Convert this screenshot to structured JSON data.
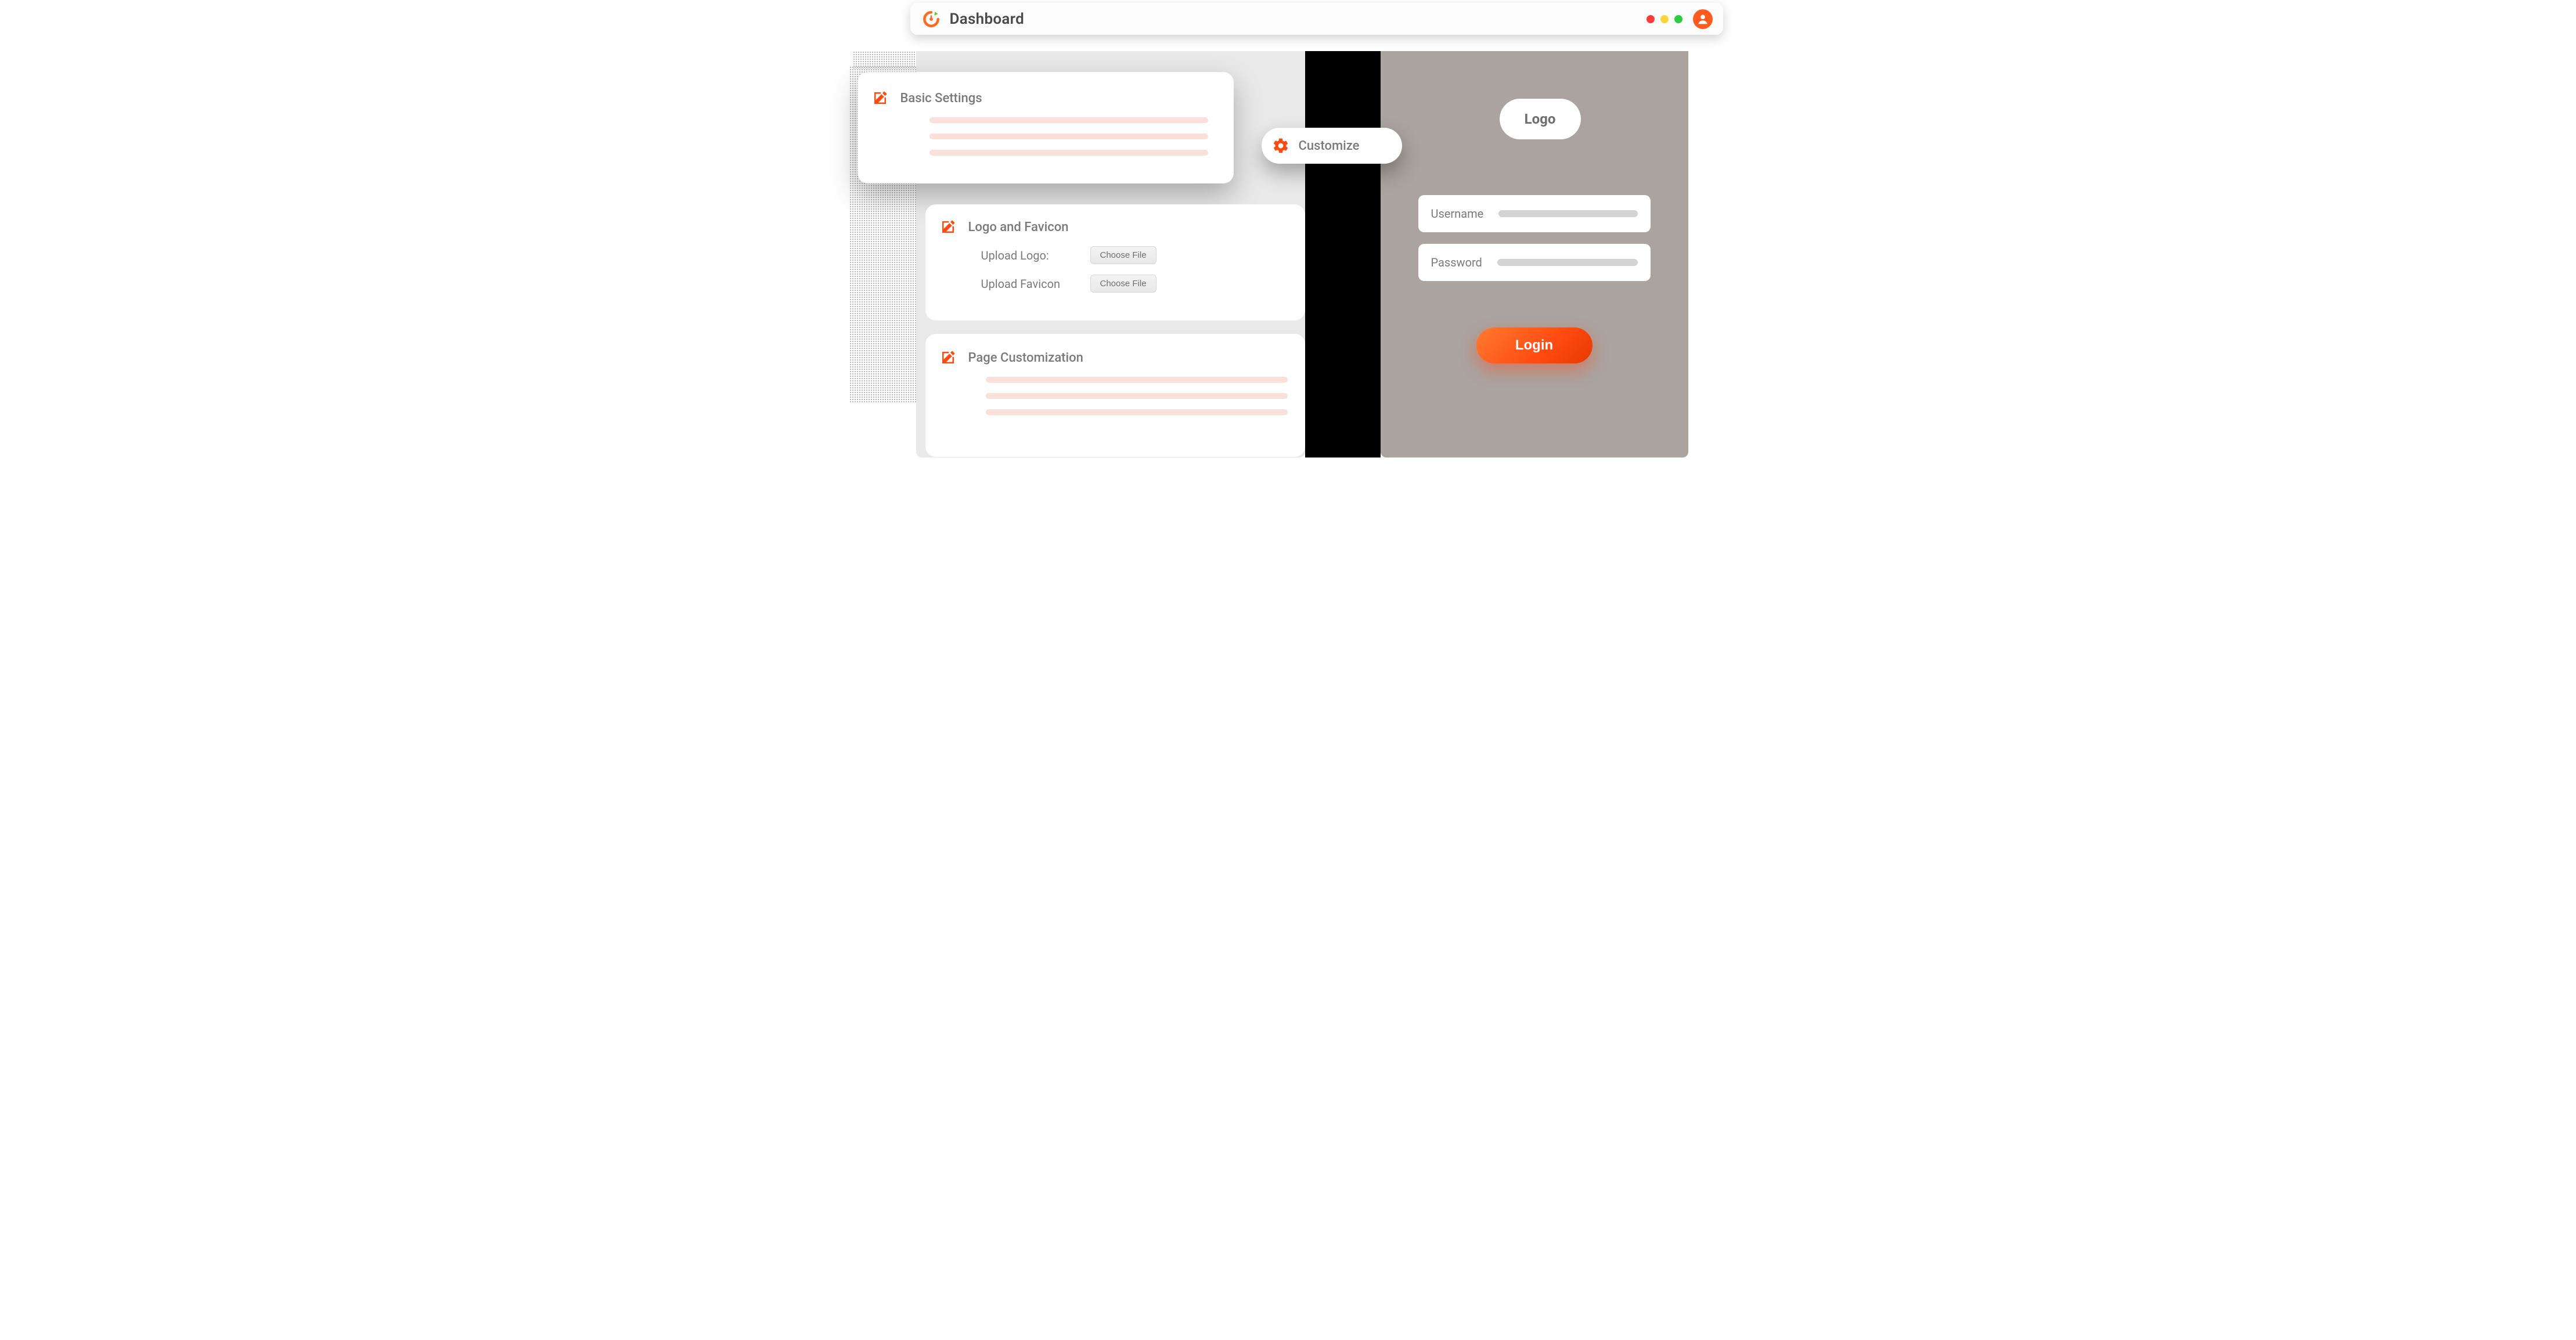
{
  "colors": {
    "accent": "#ff4b12",
    "text_muted": "#7a7a7a",
    "skeleton": "#fbe0da",
    "panel_left": "#e9e9e9",
    "panel_right": "#aba3a0"
  },
  "header": {
    "title": "Dashboard"
  },
  "customize": {
    "label": "Customize"
  },
  "cards": {
    "basic_settings": {
      "title": "Basic Settings"
    },
    "logo_favicon": {
      "title": "Logo and Favicon",
      "upload_logo_label": "Upload Logo:",
      "upload_favicon_label": "Upload Favicon",
      "choose_file_label": "Choose File"
    },
    "page_customization": {
      "title": "Page Customization"
    }
  },
  "login_preview": {
    "logo_label": "Logo",
    "username_label": "Username",
    "password_label": "Password",
    "login_button": "Login"
  }
}
